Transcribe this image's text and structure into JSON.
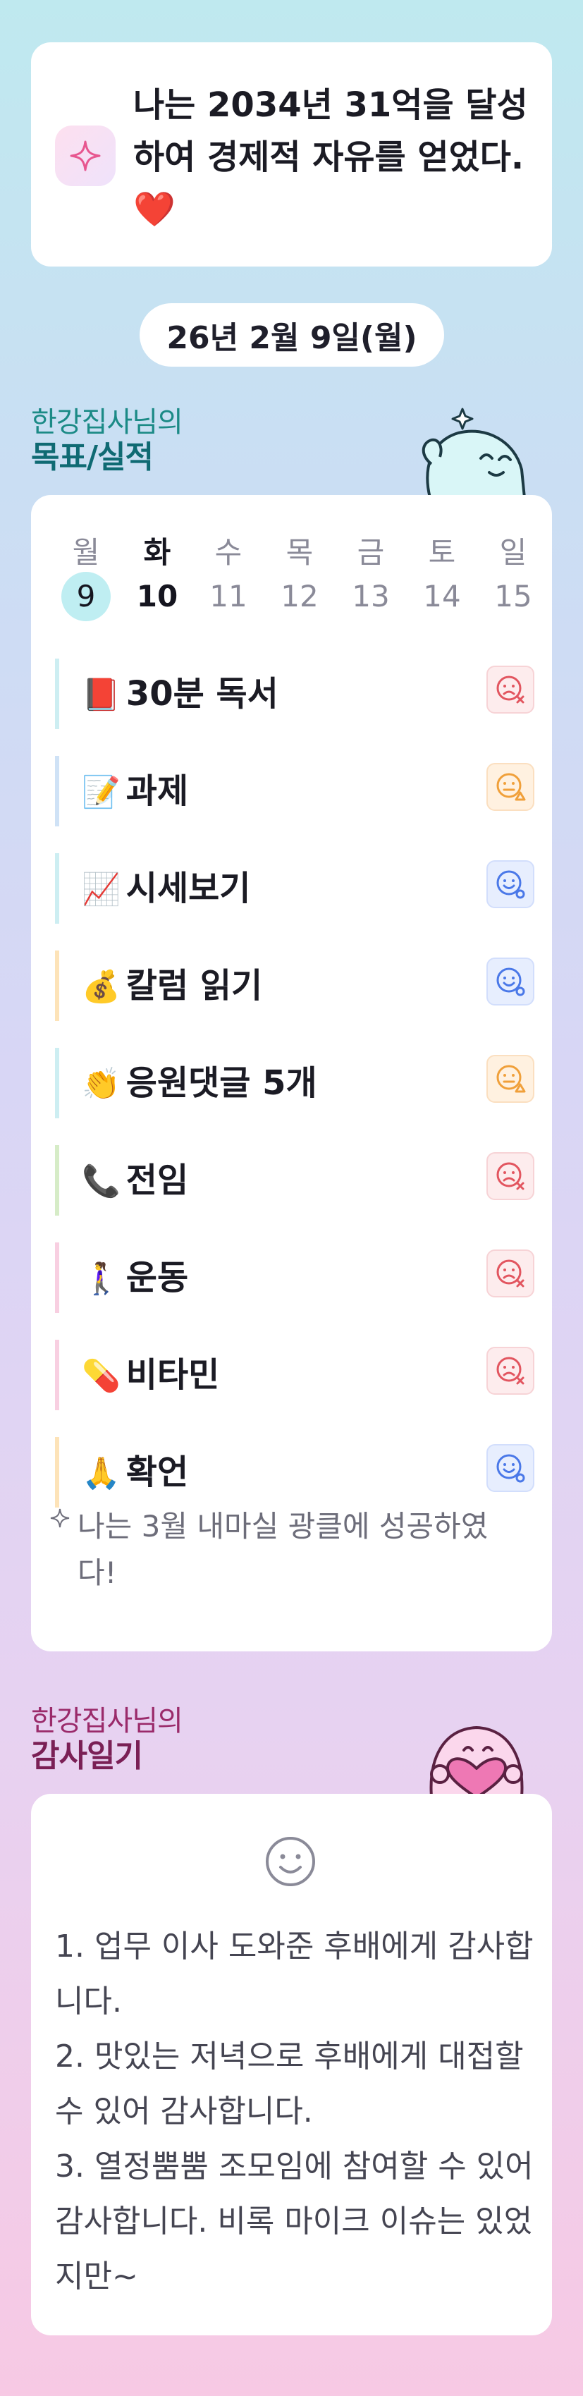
{
  "goal": {
    "icon": "sparkle-icon",
    "text": "나는 2034년 31억을 달성하여 경제적 자유를 얻었다.",
    "emoji": "❤️"
  },
  "date": {
    "label": "26년 2월 9일(월)"
  },
  "goals_section": {
    "owner": "한강집사님의",
    "title": "목표/실적"
  },
  "week": {
    "days": [
      {
        "name": "월",
        "date": "9"
      },
      {
        "name": "화",
        "date": "10"
      },
      {
        "name": "수",
        "date": "11"
      },
      {
        "name": "목",
        "date": "12"
      },
      {
        "name": "금",
        "date": "13"
      },
      {
        "name": "토",
        "date": "14"
      },
      {
        "name": "일",
        "date": "15"
      }
    ],
    "selected_index": 0,
    "today_index": 1
  },
  "tasks": [
    {
      "emoji": "📕",
      "label": "30분 독서",
      "status": "fail",
      "icon": "sad-x-icon",
      "bar_color": "#cdeef2"
    },
    {
      "emoji": "📝",
      "label": "과제",
      "status": "partial",
      "icon": "neutral-triangle-icon",
      "bar_color": "#cfe2f6"
    },
    {
      "emoji": "📈",
      "label": "시세보기",
      "status": "done",
      "icon": "smile-circle-icon",
      "bar_color": "#cdeef2"
    },
    {
      "emoji": "💰",
      "label": "칼럼 읽기",
      "status": "done",
      "icon": "smile-circle-icon",
      "bar_color": "#fde3b8"
    },
    {
      "emoji": "👏",
      "label": "응원댓글 5개",
      "status": "partial",
      "icon": "neutral-triangle-icon",
      "bar_color": "#cdeef2"
    },
    {
      "emoji": "📞",
      "label": "전임",
      "status": "fail",
      "icon": "sad-x-icon",
      "bar_color": "#d6ecc7"
    },
    {
      "emoji": "🚶‍♀️",
      "label": "운동",
      "status": "fail",
      "icon": "sad-x-icon",
      "bar_color": "#f8cfe1"
    },
    {
      "emoji": "💊",
      "label": "비타민",
      "status": "fail",
      "icon": "sad-x-icon",
      "bar_color": "#f8cfe1"
    },
    {
      "emoji": "🙏",
      "label": "확언",
      "status": "done",
      "icon": "smile-circle-icon",
      "bar_color": "#fde3b8"
    }
  ],
  "affirmation_note": "나는 3월 내마실 광클에 성공하였다!",
  "gratitude_section": {
    "owner": "한강집사님의",
    "title": "감사일기"
  },
  "gratitude": {
    "icon": "smile-icon",
    "text": "1. 업무 이사 도와준 후배에게 감사합니다.\n2. 맛있는 저녁으로 후배에게 대접할 수 있어 감사합니다.\n3. 열정뿜뿜 조모임에 참여할 수 있어 감사합니다. 비록 마이크 이슈는 있었지만~"
  },
  "colors": {
    "accent_teal": "#1b8a86",
    "accent_plum": "#9a2a6a",
    "fail": "#e2555f",
    "partial": "#f0a03a",
    "done": "#4a78e8"
  }
}
